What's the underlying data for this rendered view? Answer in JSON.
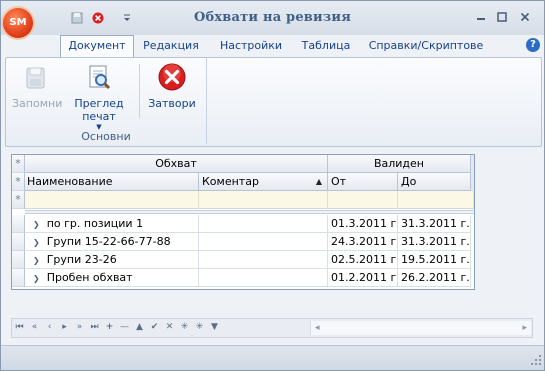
{
  "app": {
    "logo_text": "SM",
    "title": "Обхвати на ревизия"
  },
  "tabs": [
    {
      "label": "Документ"
    },
    {
      "label": "Редакция"
    },
    {
      "label": "Настройки"
    },
    {
      "label": "Таблица"
    },
    {
      "label": "Справки/Скриптове"
    }
  ],
  "help_icon": "?",
  "ribbon": {
    "save_label": "Запомни",
    "preview_label_1": "Преглед",
    "preview_label_2": "печат",
    "preview_arrow": "▼",
    "close_label": "Затвори",
    "group_label": "Основни"
  },
  "grid": {
    "band_scope": "Обхват",
    "band_valid": "Валиден",
    "col_name": "Наименование",
    "col_comment": "Коментар",
    "col_from": "От",
    "col_to": "До",
    "sort_glyph": "▲",
    "indicator": "*",
    "rows": [
      {
        "name": "по гр. позиции 1",
        "comment": "",
        "from": "01.3.2011 г.",
        "to": "31.3.2011 г."
      },
      {
        "name": "Групи 15-22-66-77-88",
        "comment": "",
        "from": "24.3.2011 г.",
        "to": "31.3.2011 г."
      },
      {
        "name": "Групи 23-26",
        "comment": "",
        "from": "02.5.2011 г.",
        "to": "19.5.2011 г."
      },
      {
        "name": "Пробен обхват",
        "comment": "",
        "from": "01.2.2011 г.",
        "to": "26.2.2011 г."
      }
    ]
  },
  "navigator": [
    "⏮",
    "«",
    "‹",
    "▸",
    "»",
    "⏭",
    "+",
    "—",
    "▲",
    "✔",
    "✕",
    "✳",
    "✳",
    "▼"
  ],
  "colors": {
    "accent": "#15428b",
    "close_red": "#d81e1e",
    "orb": "#e2401a"
  }
}
